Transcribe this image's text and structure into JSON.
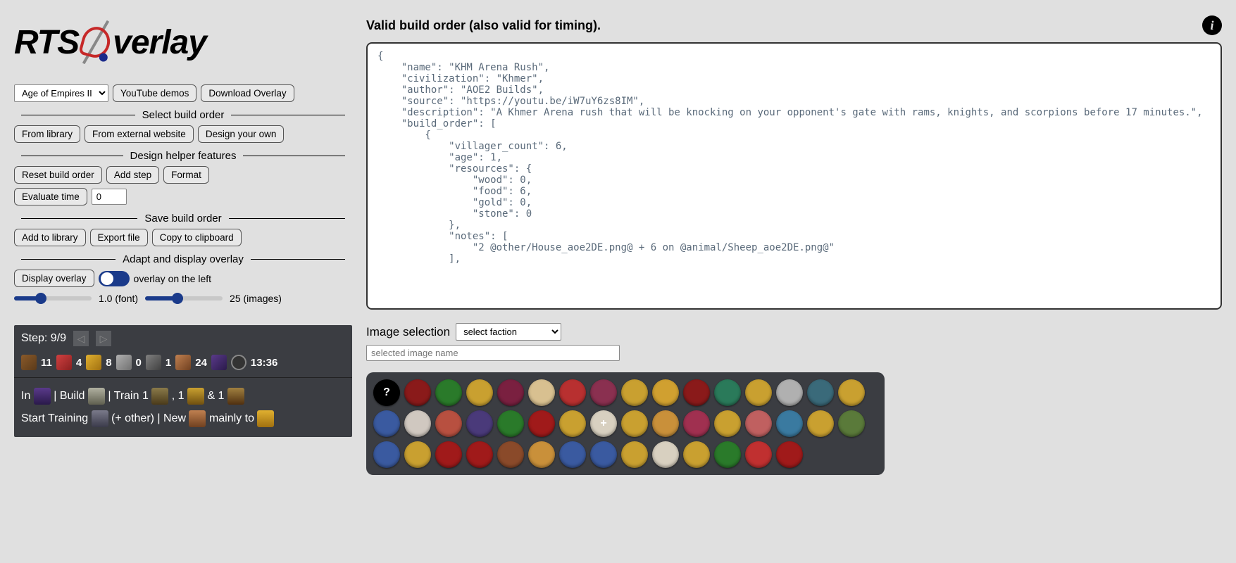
{
  "logo": {
    "text_left": "RTS ",
    "text_right": "verlay"
  },
  "controls": {
    "game_select": "Age of Empires II",
    "youtube": "YouTube demos",
    "download": "Download Overlay"
  },
  "sections": {
    "select_bo": "Select build order",
    "from_library": "From library",
    "from_external": "From external website",
    "design_own": "Design your own",
    "helper": "Design helper features",
    "reset": "Reset build order",
    "add_step": "Add step",
    "format": "Format",
    "eval_time": "Evaluate time",
    "eval_value": "0",
    "save": "Save build order",
    "add_lib": "Add to library",
    "export": "Export file",
    "copy": "Copy to clipboard",
    "adapt": "Adapt and display overlay",
    "display": "Display overlay",
    "toggle_label": "overlay on the left",
    "font_label": "1.0 (font)",
    "images_label": "25 (images)"
  },
  "overlay": {
    "step_label": "Step: 9/9",
    "resources": {
      "wood": "11",
      "food": "4",
      "gold": "8",
      "stone": "0",
      "builder": "1",
      "villager": "24",
      "time": "13:36"
    },
    "note_line1_a": "In ",
    "note_line1_b": " | Build ",
    "note_line1_c": " | Train 1 ",
    "note_line1_d": " , 1 ",
    "note_line1_e": " & 1 ",
    "note_line2_a": "Start Training ",
    "note_line2_b": " (+ other) | New ",
    "note_line2_c": " mainly to "
  },
  "right": {
    "status": "Valid build order (also valid for timing).",
    "code": "{\n    \"name\": \"KHM Arena Rush\",\n    \"civilization\": \"Khmer\",\n    \"author\": \"AOE2 Builds\",\n    \"source\": \"https://youtu.be/iW7uY6zs8IM\",\n    \"description\": \"A Khmer Arena rush that will be knocking on your opponent's gate with rams, knights, and scorpions before 17 minutes.\",\n    \"build_order\": [\n        {\n            \"villager_count\": 6,\n            \"age\": 1,\n            \"resources\": {\n                \"wood\": 0,\n                \"food\": 6,\n                \"gold\": 0,\n                \"stone\": 0\n            },\n            \"notes\": [\n                \"2 @other/House_aoe2DE.png@ + 6 on @animal/Sheep_aoe2DE.png@\"\n            ],",
    "img_sel_label": "Image selection",
    "faction_select": "select faction",
    "img_name_placeholder": "selected image name"
  },
  "factions": [
    {
      "bg": "#000",
      "sym": "?"
    },
    {
      "bg": "#8a1a1a",
      "sym": ""
    },
    {
      "bg": "#2a7a2a",
      "sym": ""
    },
    {
      "bg": "#c9a030",
      "sym": ""
    },
    {
      "bg": "#7a2040",
      "sym": ""
    },
    {
      "bg": "#d8c090",
      "sym": ""
    },
    {
      "bg": "#b83030",
      "sym": ""
    },
    {
      "bg": "#8a3050",
      "sym": ""
    },
    {
      "bg": "#c9a030",
      "sym": ""
    },
    {
      "bg": "#d0a030",
      "sym": ""
    },
    {
      "bg": "#8a1a1a",
      "sym": ""
    },
    {
      "bg": "#2a7a5a",
      "sym": ""
    },
    {
      "bg": "#c9a030",
      "sym": ""
    },
    {
      "bg": "#b0b0b0",
      "sym": ""
    },
    {
      "bg": "#3a6a7a",
      "sym": ""
    },
    {
      "bg": "#c9a030",
      "sym": ""
    },
    {
      "bg": "#3a5aa0",
      "sym": ""
    },
    {
      "bg": "#d0c8c0",
      "sym": ""
    },
    {
      "bg": "#b85040",
      "sym": ""
    },
    {
      "bg": "#4a3a7a",
      "sym": ""
    },
    {
      "bg": "#2a7a2a",
      "sym": ""
    },
    {
      "bg": "#a01a1a",
      "sym": ""
    },
    {
      "bg": "#c9a030",
      "sym": ""
    },
    {
      "bg": "#d8d0c0",
      "sym": "+"
    },
    {
      "bg": "#c9a030",
      "sym": ""
    },
    {
      "bg": "#c9903a",
      "sym": ""
    },
    {
      "bg": "#a03050",
      "sym": ""
    },
    {
      "bg": "#c9a030",
      "sym": ""
    },
    {
      "bg": "#c06060",
      "sym": ""
    },
    {
      "bg": "#3a7aa0",
      "sym": ""
    },
    {
      "bg": "#c9a030",
      "sym": ""
    },
    {
      "bg": "#5a7a3a",
      "sym": ""
    },
    {
      "bg": "#3a5aa0",
      "sym": ""
    },
    {
      "bg": "#c9a030",
      "sym": ""
    },
    {
      "bg": "#a01a1a",
      "sym": ""
    },
    {
      "bg": "#a01a1a",
      "sym": ""
    },
    {
      "bg": "#8a4a2a",
      "sym": ""
    },
    {
      "bg": "#c9903a",
      "sym": ""
    },
    {
      "bg": "#3a5aa0",
      "sym": ""
    },
    {
      "bg": "#3a5aa0",
      "sym": ""
    },
    {
      "bg": "#c9a030",
      "sym": ""
    },
    {
      "bg": "#d8d0c0",
      "sym": ""
    },
    {
      "bg": "#c9a030",
      "sym": ""
    },
    {
      "bg": "#2a7a2a",
      "sym": ""
    },
    {
      "bg": "#c03030",
      "sym": ""
    },
    {
      "bg": "#a01a1a",
      "sym": ""
    }
  ]
}
